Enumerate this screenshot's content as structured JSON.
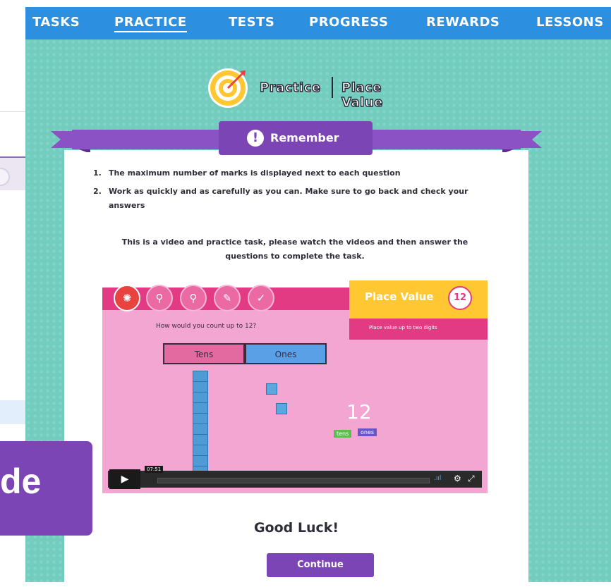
{
  "nav": {
    "items": [
      "TASKS",
      "PRACTICE",
      "TESTS",
      "PROGRESS",
      "REWARDS",
      "LESSONS"
    ],
    "active": "PRACTICE"
  },
  "header": {
    "left": "Practice",
    "right": "Place Value"
  },
  "remember": {
    "title": "Remember",
    "rules": [
      {
        "num": "1.",
        "text": "The maximum number of marks is displayed next to each question"
      },
      {
        "num": "2.",
        "text": "Work as quickly and as carefully as you can. Make sure to go back and check your answers"
      }
    ],
    "note": "This is a video and practice task, please watch the videos and then answer the questions to complete the task."
  },
  "video": {
    "title": "Place Value",
    "badge": "12",
    "subtitle": "Place value up to two digits",
    "question": "How would you count up to 12?",
    "tens_label": "Tens",
    "ones_label": "Ones",
    "big_number": "12",
    "tag_tens": "tens",
    "tag_ones": "ones",
    "time": "07:51",
    "play_icon": "▶",
    "volume_icon": ".ııl",
    "gear_icon": "⚙",
    "fullscreen_icon": "⤢"
  },
  "footer": {
    "good_luck": "Good Luck!",
    "continue": "Continue"
  },
  "overlay": {
    "text": "de"
  },
  "colors": {
    "nav": "#2d8fe0",
    "teal": "#73cdbf",
    "purple": "#7c45b5",
    "pink": "#e23a83",
    "yellow": "#ffc832"
  }
}
